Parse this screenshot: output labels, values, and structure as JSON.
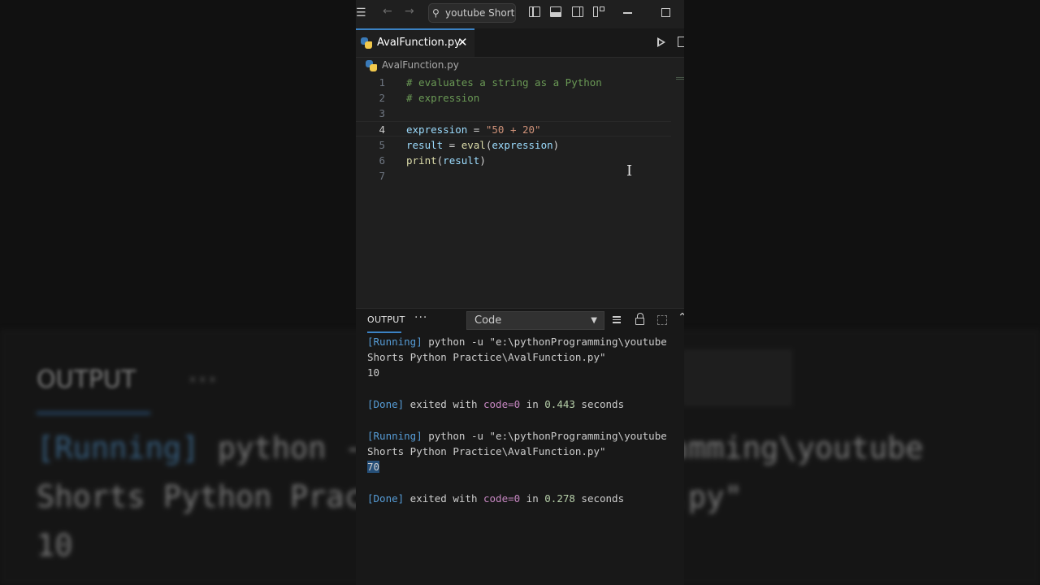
{
  "titlebar": {
    "search_text": "youtube Short...",
    "icons": [
      "menu-icon",
      "back-arrow-icon",
      "forward-arrow-icon",
      "search-icon",
      "toggle-sidebar-icon",
      "toggle-panel-icon",
      "toggle-secondary-sidebar-icon",
      "customize-layout-icon",
      "minimize-icon",
      "maximize-icon"
    ]
  },
  "tab": {
    "label": "AvalFunction.py",
    "close": "✕"
  },
  "breadcrumb": {
    "label": "AvalFunction.py"
  },
  "editor": {
    "active_line": 4,
    "lines": [
      {
        "num": "1",
        "text": "# evaluates a string as a Python"
      },
      {
        "num": "2",
        "text": "# expression"
      },
      {
        "num": "3",
        "text": ""
      },
      {
        "num": "4",
        "var": "expression",
        "op": " = ",
        "str": "\"50 + 20\""
      },
      {
        "num": "5",
        "var": "result",
        "op": " = ",
        "fn": "eval",
        "p1": "(",
        "arg": "expression",
        "p2": ")"
      },
      {
        "num": "6",
        "fn": "print",
        "p1": "(",
        "arg": "result",
        "p2": ")"
      },
      {
        "num": "7",
        "text": ""
      }
    ]
  },
  "panel": {
    "tab_label": "OUTPUT",
    "more": "···",
    "dropdown_value": "Code",
    "output": {
      "run1_tag": "[Running]",
      "run1_cmd": " python -u \"e:\\pythonProgramming\\youtube",
      "run1_cont": "Shorts Python Practice\\AvalFunction.py\"",
      "run1_result": "10",
      "done1_tag": "[Done]",
      "done1_a": " exited with ",
      "done1_code": "code=0",
      "done1_b": " in ",
      "done1_time": "0.443",
      "done1_c": " seconds",
      "run2_tag": "[Running]",
      "run2_cmd": " python -u \"e:\\pythonProgramming\\youtube",
      "run2_cont": "Shorts Python Practice\\AvalFunction.py\"",
      "run2_result": "70",
      "done2_tag": "[Done]",
      "done2_a": " exited with ",
      "done2_code": "code=0",
      "done2_b": " in ",
      "done2_time": "0.278",
      "done2_c": " seconds"
    }
  },
  "background": {
    "output_label": "OUTPUT",
    "dots": "···",
    "line1_tag": "[Running]",
    "line1_text": " python -u \"e:\\pythonProgramming\\youtube",
    "line2_text": "Shorts Python Practice\\AvalFunction.py\"",
    "line3_text": "10"
  },
  "colors": {
    "accent": "#3b82c4",
    "comment": "#6a9955",
    "string": "#ce9178",
    "function": "#dcdcaa",
    "variable": "#9cdcfe",
    "output_tag": "#569cd6",
    "output_keyword": "#c586c0",
    "output_number": "#b5cea8"
  }
}
